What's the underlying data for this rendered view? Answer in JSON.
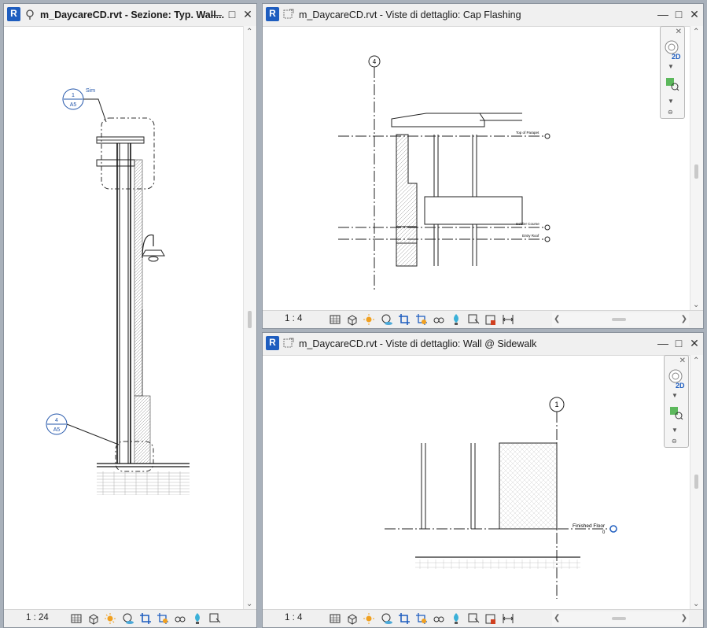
{
  "app": {
    "logo_letter": "R"
  },
  "windows": {
    "left": {
      "title": "m_DaycareCD.rvt - Sezione: Typ. Wall...",
      "scale": "1 : 24",
      "callouts": [
        {
          "top": "1",
          "bottom": "A5",
          "note": "Sim"
        },
        {
          "top": "4",
          "bottom": "A5"
        }
      ]
    },
    "top_right": {
      "title": "m_DaycareCD.rvt - Viste di dettaglio: Cap Flashing",
      "scale": "1 : 4",
      "grid_label": "4",
      "levels": [
        {
          "name": "Top of Parapet"
        },
        {
          "name": "Soldier Course"
        },
        {
          "name": "Entry Roof"
        }
      ]
    },
    "bottom_right": {
      "title": "m_DaycareCD.rvt - Viste di dettaglio: Wall @ Sidewalk",
      "scale": "1 : 4",
      "grid_label": "1",
      "level": {
        "name": "Finished Floor",
        "elevation": "0"
      }
    }
  },
  "nav": {
    "label_2d": "2D"
  },
  "icons": [
    "window-close-icon",
    "window-restore-icon",
    "window-minimize-icon",
    "navigation-wheel-icon",
    "zoom-region-icon",
    "detail-level-icon",
    "visual-style-icon",
    "sun-path-icon",
    "shadows-icon",
    "crop-view-icon",
    "show-crop-icon",
    "temporary-hide-icon",
    "reveal-hidden-icon",
    "analytical-model-icon",
    "highlight-icon",
    "constraints-icon"
  ],
  "colors": {
    "accent": "#1e5dbf",
    "callout_blue": "#2255aa"
  }
}
